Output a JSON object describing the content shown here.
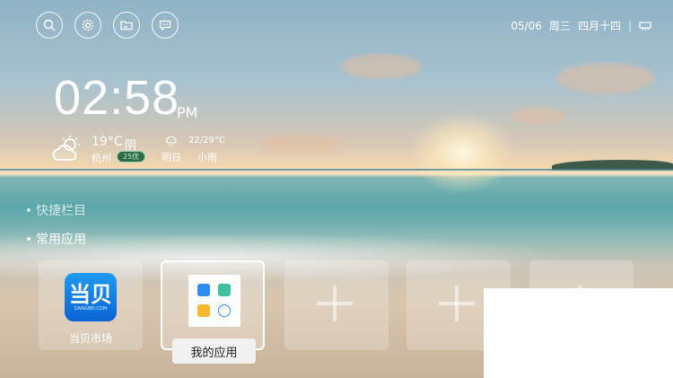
{
  "top_icons": [
    {
      "name": "search-icon"
    },
    {
      "name": "settings-icon"
    },
    {
      "name": "folder-icon"
    },
    {
      "name": "message-icon"
    }
  ],
  "status": {
    "date": "05/06",
    "weekday": "周三",
    "lunar": "四月十四",
    "separator": "|",
    "network_icon": "ethernet-icon"
  },
  "clock": {
    "time": "02:58",
    "ampm": "PM"
  },
  "weather": {
    "today_icon": "sun-cloud-icon",
    "temp": "19°C",
    "condition": "阴",
    "city": "杭州",
    "aqi": "25优",
    "tomorrow_icon": "cloud-rain-icon",
    "tomorrow_range": "22/29°C",
    "tomorrow_label": "明日",
    "tomorrow_condition": "小雨"
  },
  "menu": [
    {
      "label": "快捷栏目"
    },
    {
      "label": "常用应用"
    }
  ],
  "tiles": {
    "dangbei": {
      "logo_text": "当贝",
      "logo_sub": "DANGBEI.COM",
      "label": "当贝市场"
    },
    "my_apps": {
      "label": "我的应用"
    }
  },
  "colors": {
    "accent_blue": "#0a63d6",
    "aqi_green": "#2f6b48"
  }
}
